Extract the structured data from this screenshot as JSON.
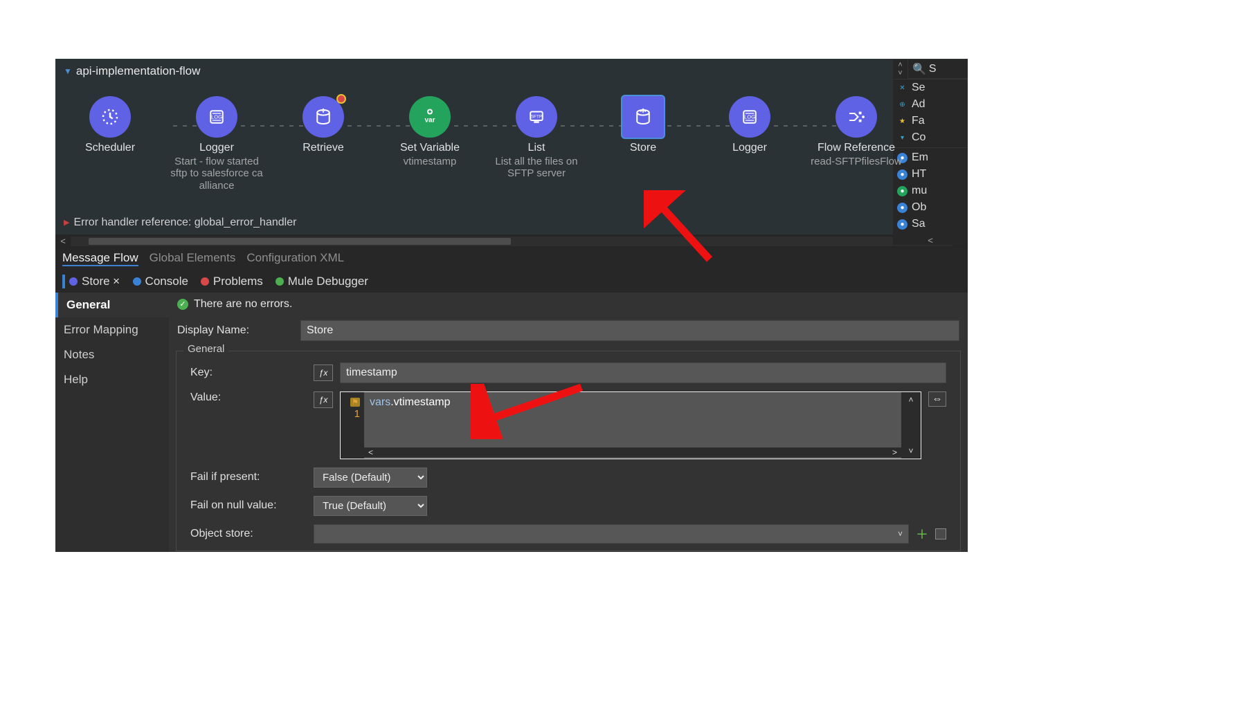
{
  "flow": {
    "name": "api-implementation-flow"
  },
  "nodes": [
    {
      "title": "Scheduler",
      "sub": "",
      "color": "purple",
      "icon": "clock"
    },
    {
      "title": "Logger",
      "sub": "Start - flow started sftp to salesforce ca alliance",
      "color": "purple",
      "icon": "log"
    },
    {
      "title": "Retrieve",
      "sub": "",
      "color": "purple",
      "icon": "db",
      "badge": true
    },
    {
      "title": "Set Variable",
      "sub": "vtimestamp",
      "color": "green",
      "icon": "var"
    },
    {
      "title": "List",
      "sub": "List all the files on SFTP server",
      "color": "purple",
      "icon": "sftp"
    },
    {
      "title": "Store",
      "sub": "",
      "color": "purple",
      "icon": "db",
      "selected": true
    },
    {
      "title": "Logger",
      "sub": "",
      "color": "purple",
      "icon": "log"
    },
    {
      "title": "Flow Reference",
      "sub": "read-SFTPfilesFlow",
      "color": "purple",
      "icon": "flowref"
    }
  ],
  "error_handler": "Error handler reference: global_error_handler",
  "editor_tabs": [
    "Message Flow",
    "Global Elements",
    "Configuration XML"
  ],
  "bottom_tabs": [
    {
      "label": "Store",
      "dot": "#6062e6",
      "active": true,
      "close": true
    },
    {
      "label": "Console",
      "dot": "#3a82d6"
    },
    {
      "label": "Problems",
      "dot": "#d94848"
    },
    {
      "label": "Mule Debugger",
      "dot": "#4caf50"
    }
  ],
  "sidebar_sections": [
    "General",
    "Error Mapping",
    "Notes",
    "Help"
  ],
  "status_message": "There are no errors.",
  "form": {
    "display_name_label": "Display Name:",
    "display_name_value": "Store",
    "group_label": "General",
    "key_label": "Key:",
    "key_value": "timestamp",
    "value_label": "Value:",
    "code_line_no": "1",
    "code_tok1": "vars",
    "code_tok2": ".vtimestamp",
    "fail_if_present_label": "Fail if present:",
    "fail_if_present_value": "False (Default)",
    "fail_on_null_label": "Fail on null value:",
    "fail_on_null_value": "True (Default)",
    "object_store_label": "Object store:"
  },
  "right_strip": {
    "search_placeholder": "S",
    "items": [
      {
        "glyph": "✕",
        "color": "#3aa0d0",
        "text": "Se"
      },
      {
        "glyph": "⊕",
        "color": "#3aa0d0",
        "text": "Ad"
      },
      {
        "glyph": "★",
        "color": "#e9c137",
        "text": "Fa"
      },
      {
        "glyph": "▾",
        "color": "#3aa0d0",
        "text": "Co"
      },
      {
        "glyph": "●",
        "color": "#3a82d6",
        "text": "Em"
      },
      {
        "glyph": "●",
        "color": "#3a82d6",
        "text": "HT"
      },
      {
        "glyph": "●",
        "color": "#24a35d",
        "text": "mu"
      },
      {
        "glyph": "●",
        "color": "#3a82d6",
        "text": "Ob"
      },
      {
        "glyph": "●",
        "color": "#3a82d6",
        "text": "Sa"
      }
    ]
  }
}
